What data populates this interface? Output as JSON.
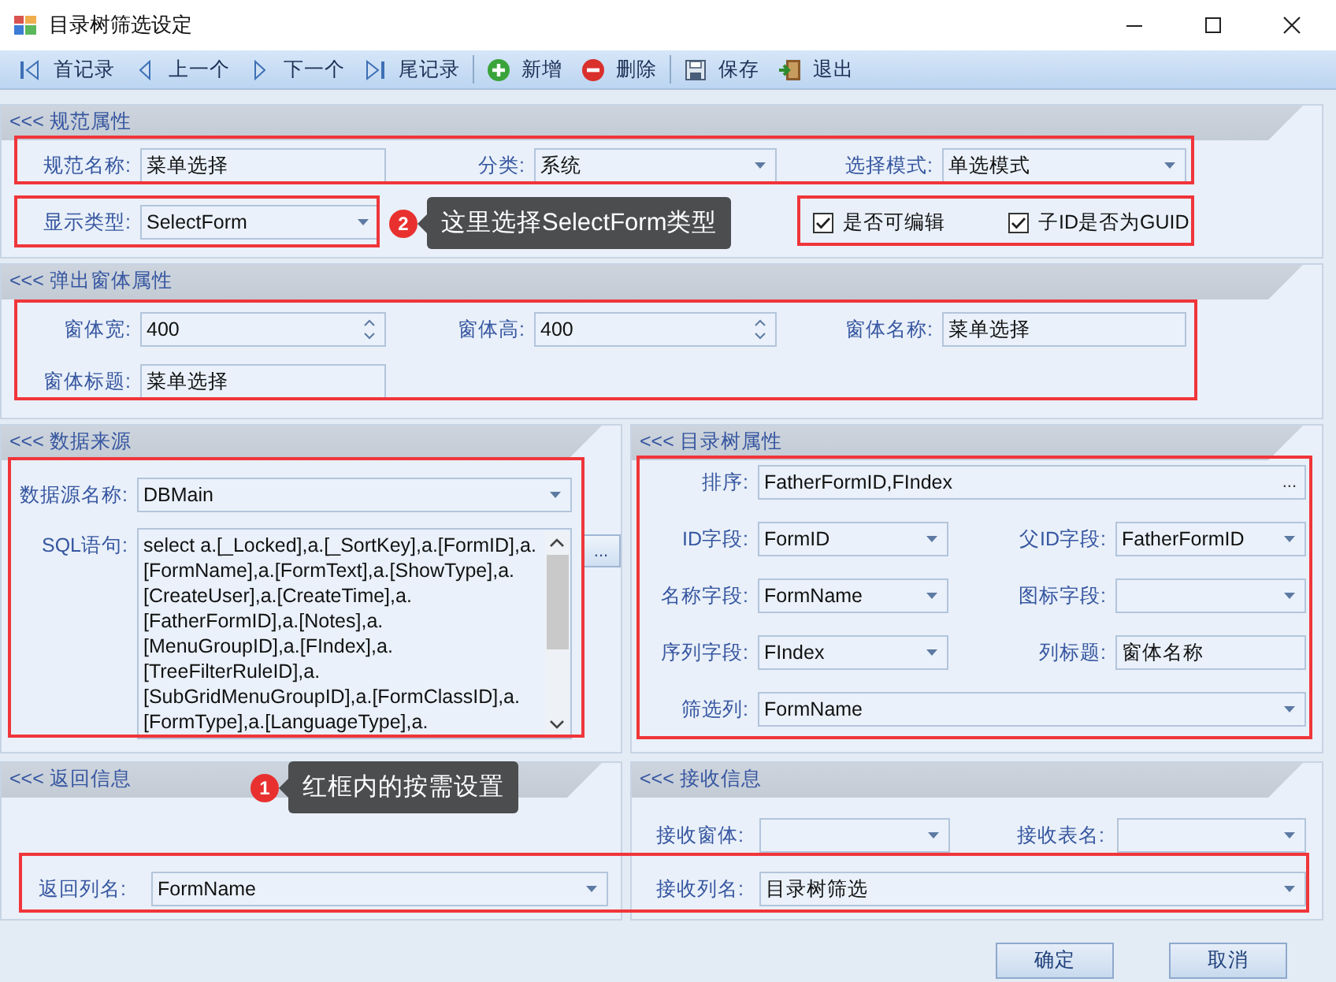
{
  "window": {
    "title": "目录树筛选设定"
  },
  "toolbar": [
    [
      {
        "kind": "first",
        "label": "首记录"
      },
      {
        "kind": "prev",
        "label": "上一个"
      },
      {
        "kind": "next",
        "label": "下一个"
      },
      {
        "kind": "last",
        "label": "尾记录"
      }
    ],
    [
      {
        "kind": "add",
        "label": "新增"
      },
      {
        "kind": "delete",
        "label": "删除"
      }
    ],
    [
      {
        "kind": "save",
        "label": "保存"
      },
      {
        "kind": "exit",
        "label": "退出"
      }
    ]
  ],
  "spec": {
    "title": "<<< 规范属性",
    "rows": [
      [
        {
          "kind": "text",
          "label": "规范名称:",
          "value": "菜单选择"
        },
        {
          "kind": "combo",
          "label": "分类:",
          "value": "系统"
        },
        {
          "kind": "combo",
          "label": "选择模式:",
          "value": "单选模式"
        }
      ],
      [
        {
          "kind": "combo",
          "label": "显示类型:",
          "value": "SelectForm"
        }
      ]
    ],
    "checkboxes": [
      {
        "label": "是否可编辑",
        "checked": true
      },
      {
        "label": "子ID是否为GUID",
        "checked": true
      }
    ]
  },
  "popup": {
    "title": "<<< 弹出窗体属性",
    "rows": [
      [
        {
          "kind": "spin",
          "label": "窗体宽:",
          "value": "400"
        },
        {
          "kind": "spin",
          "label": "窗体高:",
          "value": "400"
        },
        {
          "kind": "text",
          "label": "窗体名称:",
          "value": "菜单选择"
        }
      ],
      [
        {
          "kind": "text",
          "label": "窗体标题:",
          "value": "菜单选择"
        }
      ]
    ]
  },
  "data_source": {
    "title": "<<< 数据来源",
    "rows": [
      [
        {
          "kind": "combo",
          "label": "数据源名称:",
          "value": "DBMain"
        }
      ],
      [
        {
          "kind": "textarea",
          "label": "SQL语句:",
          "button": "...",
          "lines": [
            "select a.[_Locked],a.[_SortKey],a.[FormID],a.",
            "[FormName],a.[FormText],a.[ShowType],a.",
            "[CreateUser],a.[CreateTime],a.",
            "[FatherFormID],a.[Notes],a.",
            "[MenuGroupID],a.[FIndex],a.",
            "[TreeFilterRuleID],a.",
            "[SubGridMenuGroupID],a.[FormClassID],a.",
            "[FormType],a.[LanguageType],a."
          ]
        }
      ]
    ]
  },
  "tree": {
    "title": "<<< 目录树属性",
    "rows": [
      [
        {
          "kind": "picker",
          "label": "排序:",
          "value": "FatherFormID,FIndex",
          "button": "..."
        }
      ],
      [
        {
          "kind": "combo",
          "label": "ID字段:",
          "value": "FormID"
        },
        {
          "kind": "combo",
          "label": "父ID字段:",
          "value": "FatherFormID"
        }
      ],
      [
        {
          "kind": "combo",
          "label": "名称字段:",
          "value": "FormName"
        },
        {
          "kind": "combo",
          "label": "图标字段:"
        }
      ],
      [
        {
          "kind": "combo",
          "label": "序列字段:",
          "value": "FIndex"
        },
        {
          "kind": "text",
          "label": "列标题:",
          "value": "窗体名称"
        }
      ],
      [
        {
          "kind": "combo",
          "label": "筛选列:",
          "value": "FormName"
        }
      ]
    ]
  },
  "return_info": {
    "title": "<<< 返回信息",
    "rows": [
      [
        {
          "kind": "combo",
          "label": "返回列名:",
          "value": "FormName"
        }
      ]
    ]
  },
  "receive_info": {
    "title": "<<< 接收信息",
    "rows": [
      [
        {
          "kind": "combo",
          "label": "接收窗体:"
        },
        {
          "kind": "combo",
          "label": "接收表名:"
        }
      ],
      [
        {
          "kind": "combo",
          "label": "接收列名:",
          "value": "目录树筛选"
        }
      ]
    ]
  },
  "buttons": [
    "确定",
    "取消"
  ],
  "callouts": [
    {
      "number": "2",
      "text": "这里选择SelectForm类型"
    },
    {
      "number": "1",
      "text": "红框内的按需设置"
    }
  ]
}
